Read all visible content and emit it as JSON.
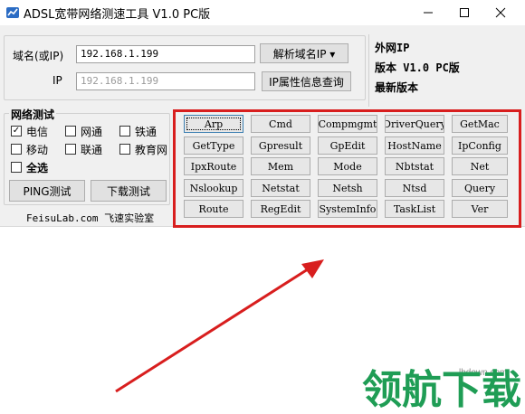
{
  "window": {
    "title": "ADSL宽带网络测速工具 V1.0 PC版"
  },
  "domain_row": {
    "label": "域名(或IP)",
    "value": "192.168.1.199",
    "button": "解析域名IP ▾"
  },
  "ip_row": {
    "label": "IP",
    "value": "192.168.1.199",
    "button": "IP属性信息查询"
  },
  "info_panel": {
    "line1": "外网IP",
    "line2": "版本 V1.0 PC版",
    "line3": "最新版本"
  },
  "network_test": {
    "title": "网络测试",
    "options": [
      {
        "label": "电信",
        "checked": true
      },
      {
        "label": "网通",
        "checked": false
      },
      {
        "label": "铁通",
        "checked": false
      },
      {
        "label": "移动",
        "checked": false
      },
      {
        "label": "联通",
        "checked": false
      },
      {
        "label": "教育网",
        "checked": false
      }
    ],
    "select_all": "全选",
    "ping_button": "PING测试",
    "download_button": "下载测试"
  },
  "footer": "FeisuLab.com 飞速实验室",
  "commands": [
    [
      "Arp",
      "Cmd",
      "Compmgmt",
      "DriverQuery",
      "GetMac"
    ],
    [
      "GetType",
      "Gpresult",
      "GpEdit",
      "HostName",
      "IpConfig"
    ],
    [
      "IpxRoute",
      "Mem",
      "Mode",
      "Nbtstat",
      "Net"
    ],
    [
      "Nslookup",
      "Netstat",
      "Netsh",
      "Ntsd",
      "Query"
    ],
    [
      "Route",
      "RegEdit",
      "SystemInfo",
      "TaskList",
      "Ver"
    ]
  ],
  "watermark": {
    "site": "lhdown.com",
    "logo": "领航下载"
  },
  "colors": {
    "highlight": "#d81e1e",
    "watermark_green": "#1f9d55",
    "watermark_blue": "#2a6fc2"
  }
}
